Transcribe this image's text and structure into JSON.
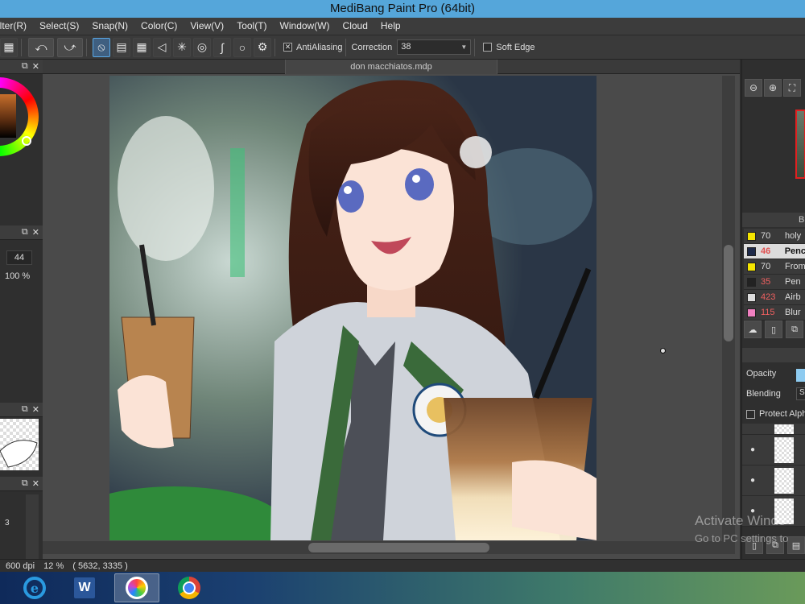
{
  "window": {
    "title": "MediBang Paint Pro (64bit)"
  },
  "menu": [
    "ilter(R)",
    "Select(S)",
    "Snap(N)",
    "Color(C)",
    "View(V)",
    "Tool(T)",
    "Window(W)",
    "Cloud",
    "Help"
  ],
  "toolbar": {
    "antialiasing_label": "AntiAliasing",
    "antialiasing_checked": true,
    "correction_label": "Correction",
    "correction_value": "38",
    "softedge_label": "Soft Edge",
    "softedge_checked": false
  },
  "left_panels": {
    "brush_size": "44",
    "opacity": "100 %",
    "item_value": "3"
  },
  "canvas": {
    "doc_tab": "don macchiatos.mdp"
  },
  "brushes": {
    "header": "Br",
    "items": [
      {
        "size": "70",
        "name": "holy",
        "color": "#f5e500",
        "selected": false,
        "size_color": "normal"
      },
      {
        "size": "46",
        "name": "Penc",
        "color": "#1e2a4a",
        "selected": true,
        "size_color": "red"
      },
      {
        "size": "70",
        "name": "From",
        "color": "#f5e500",
        "selected": false,
        "size_color": "normal"
      },
      {
        "size": "35",
        "name": "Pen",
        "color": "#222222",
        "selected": false,
        "size_color": "red"
      },
      {
        "size": "423",
        "name": "Airb",
        "color": "#dddddd",
        "selected": false,
        "size_color": "red"
      },
      {
        "size": "115",
        "name": "Blur",
        "color": "#f080c0",
        "selected": false,
        "size_color": "red"
      }
    ]
  },
  "layer_panel": {
    "opacity_label": "Opacity",
    "blending_label": "Blending",
    "blending_value": "S",
    "protect_alpha_label": "Protect Alph"
  },
  "status": {
    "dpi": "600 dpi",
    "zoom": "12 %",
    "coords": "( 5632, 3335 )"
  },
  "watermark": {
    "title": "Activate Windo",
    "subtitle": "Go to PC settings to"
  },
  "taskbar": [
    "internet-explorer",
    "word",
    "medibang-paint",
    "chrome"
  ]
}
